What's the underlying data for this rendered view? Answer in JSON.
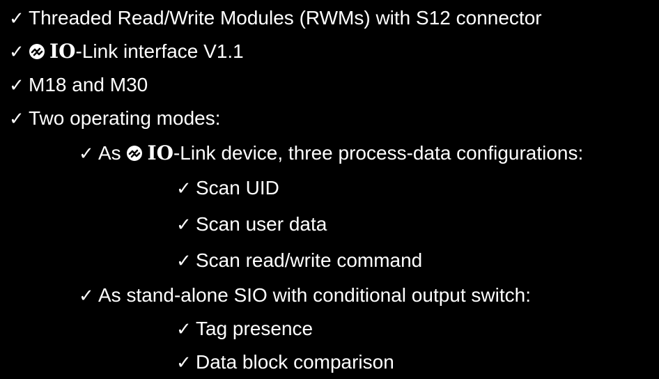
{
  "items": [
    {
      "level": 0,
      "text": "Threaded Read/Write Modules (RWMs) with S12 connector",
      "logo": false
    },
    {
      "level": 0,
      "prefix": "",
      "io": "IO",
      "text": "-Link interface V1.1",
      "logo": true
    },
    {
      "level": 0,
      "text": "M18 and M30",
      "logo": false
    },
    {
      "level": 0,
      "text": "Two operating modes:",
      "logo": false
    },
    {
      "level": 1,
      "prefix": "As ",
      "io": "IO",
      "text": "-Link device, three process-data configurations:",
      "logo": true
    },
    {
      "level": 2,
      "text": "Scan UID",
      "logo": false
    },
    {
      "level": 2,
      "text": "Scan user data",
      "logo": false
    },
    {
      "level": 2,
      "text": "Scan read/write command",
      "logo": false
    },
    {
      "level": 1,
      "text": "As stand-alone SIO with conditional output switch:",
      "logo": false
    },
    {
      "level": 2,
      "text": "Tag presence",
      "logo": false
    },
    {
      "level": 2,
      "text": "Data block comparison",
      "logo": false
    }
  ],
  "check_glyph": "✓",
  "logo_icon": "io-link-logo-icon"
}
